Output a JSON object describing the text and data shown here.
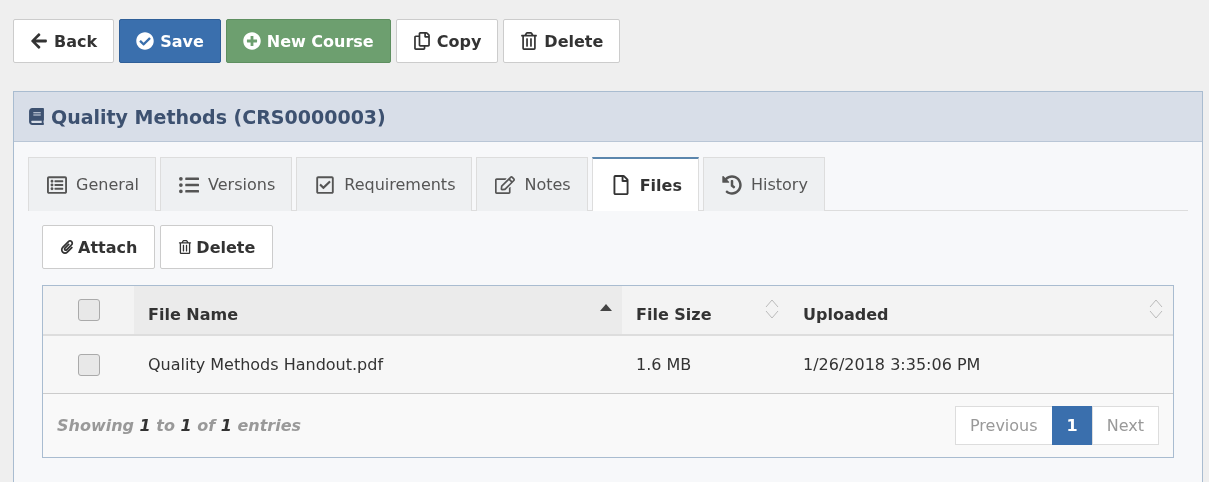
{
  "toolbar": [
    {
      "label": "Back",
      "kind": "default"
    },
    {
      "label": "Save",
      "kind": "primary"
    },
    {
      "label": "New Course",
      "kind": "success"
    },
    {
      "label": "Copy",
      "kind": "default"
    },
    {
      "label": "Delete",
      "kind": "default"
    }
  ],
  "panel": {
    "title": "Quality Methods (CRS0000003)"
  },
  "tabs": [
    {
      "label": "General",
      "selected": false
    },
    {
      "label": "Versions",
      "selected": false
    },
    {
      "label": "Requirements",
      "selected": false
    },
    {
      "label": "Notes",
      "selected": false
    },
    {
      "label": "Files",
      "selected": true
    },
    {
      "label": "History",
      "selected": false
    }
  ],
  "actions": [
    "Attach",
    "Delete"
  ],
  "table": {
    "select_all": {
      "checked": false
    },
    "columns": [
      {
        "label": "File Name",
        "sorted": true
      },
      {
        "label": "File Size",
        "sorted": false
      },
      {
        "label": "Uploaded",
        "sorted": false
      }
    ],
    "rows": [
      {
        "checked": false,
        "cells": [
          "Quality Methods Handout.pdf",
          "1.6 MB",
          "1/26/2018 3:35:06 PM"
        ]
      }
    ],
    "info": "Showing **1** to **1** of **1** entries",
    "pagination": [
      {
        "label": "Previous",
        "selected": false,
        "disabled": true
      },
      {
        "label": "1",
        "selected": true,
        "disabled": false
      },
      {
        "label": "Next",
        "selected": false,
        "disabled": true
      }
    ]
  }
}
